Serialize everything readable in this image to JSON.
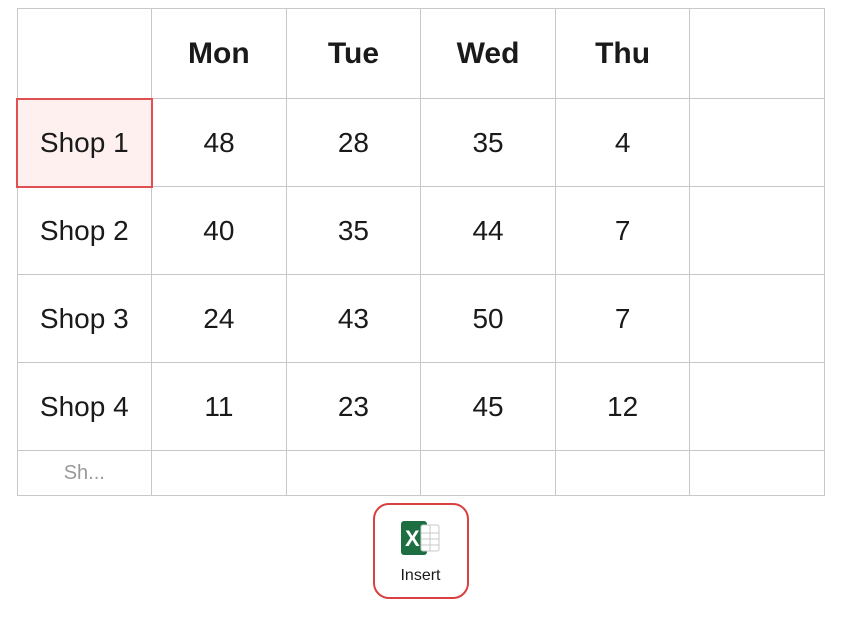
{
  "table": {
    "headers": [
      "",
      "Mon",
      "Tue",
      "Wed",
      "Thu",
      ""
    ],
    "rows": [
      {
        "name": "Shop 1",
        "mon": "48",
        "tue": "28",
        "wed": "35",
        "thu": "4",
        "highlighted": true
      },
      {
        "name": "Shop 2",
        "mon": "40",
        "tue": "35",
        "wed": "44",
        "thu": "7",
        "highlighted": false
      },
      {
        "name": "Shop 3",
        "mon": "24",
        "tue": "43",
        "wed": "50",
        "thu": "7",
        "highlighted": false
      },
      {
        "name": "Shop 4",
        "mon": "11",
        "tue": "23",
        "wed": "45",
        "thu": "12",
        "highlighted": false
      }
    ],
    "partialRow": {
      "name": "Sh...",
      "mon": "",
      "tue": "",
      "wed": "",
      "thu": ""
    }
  },
  "insertButton": {
    "label": "Insert"
  }
}
